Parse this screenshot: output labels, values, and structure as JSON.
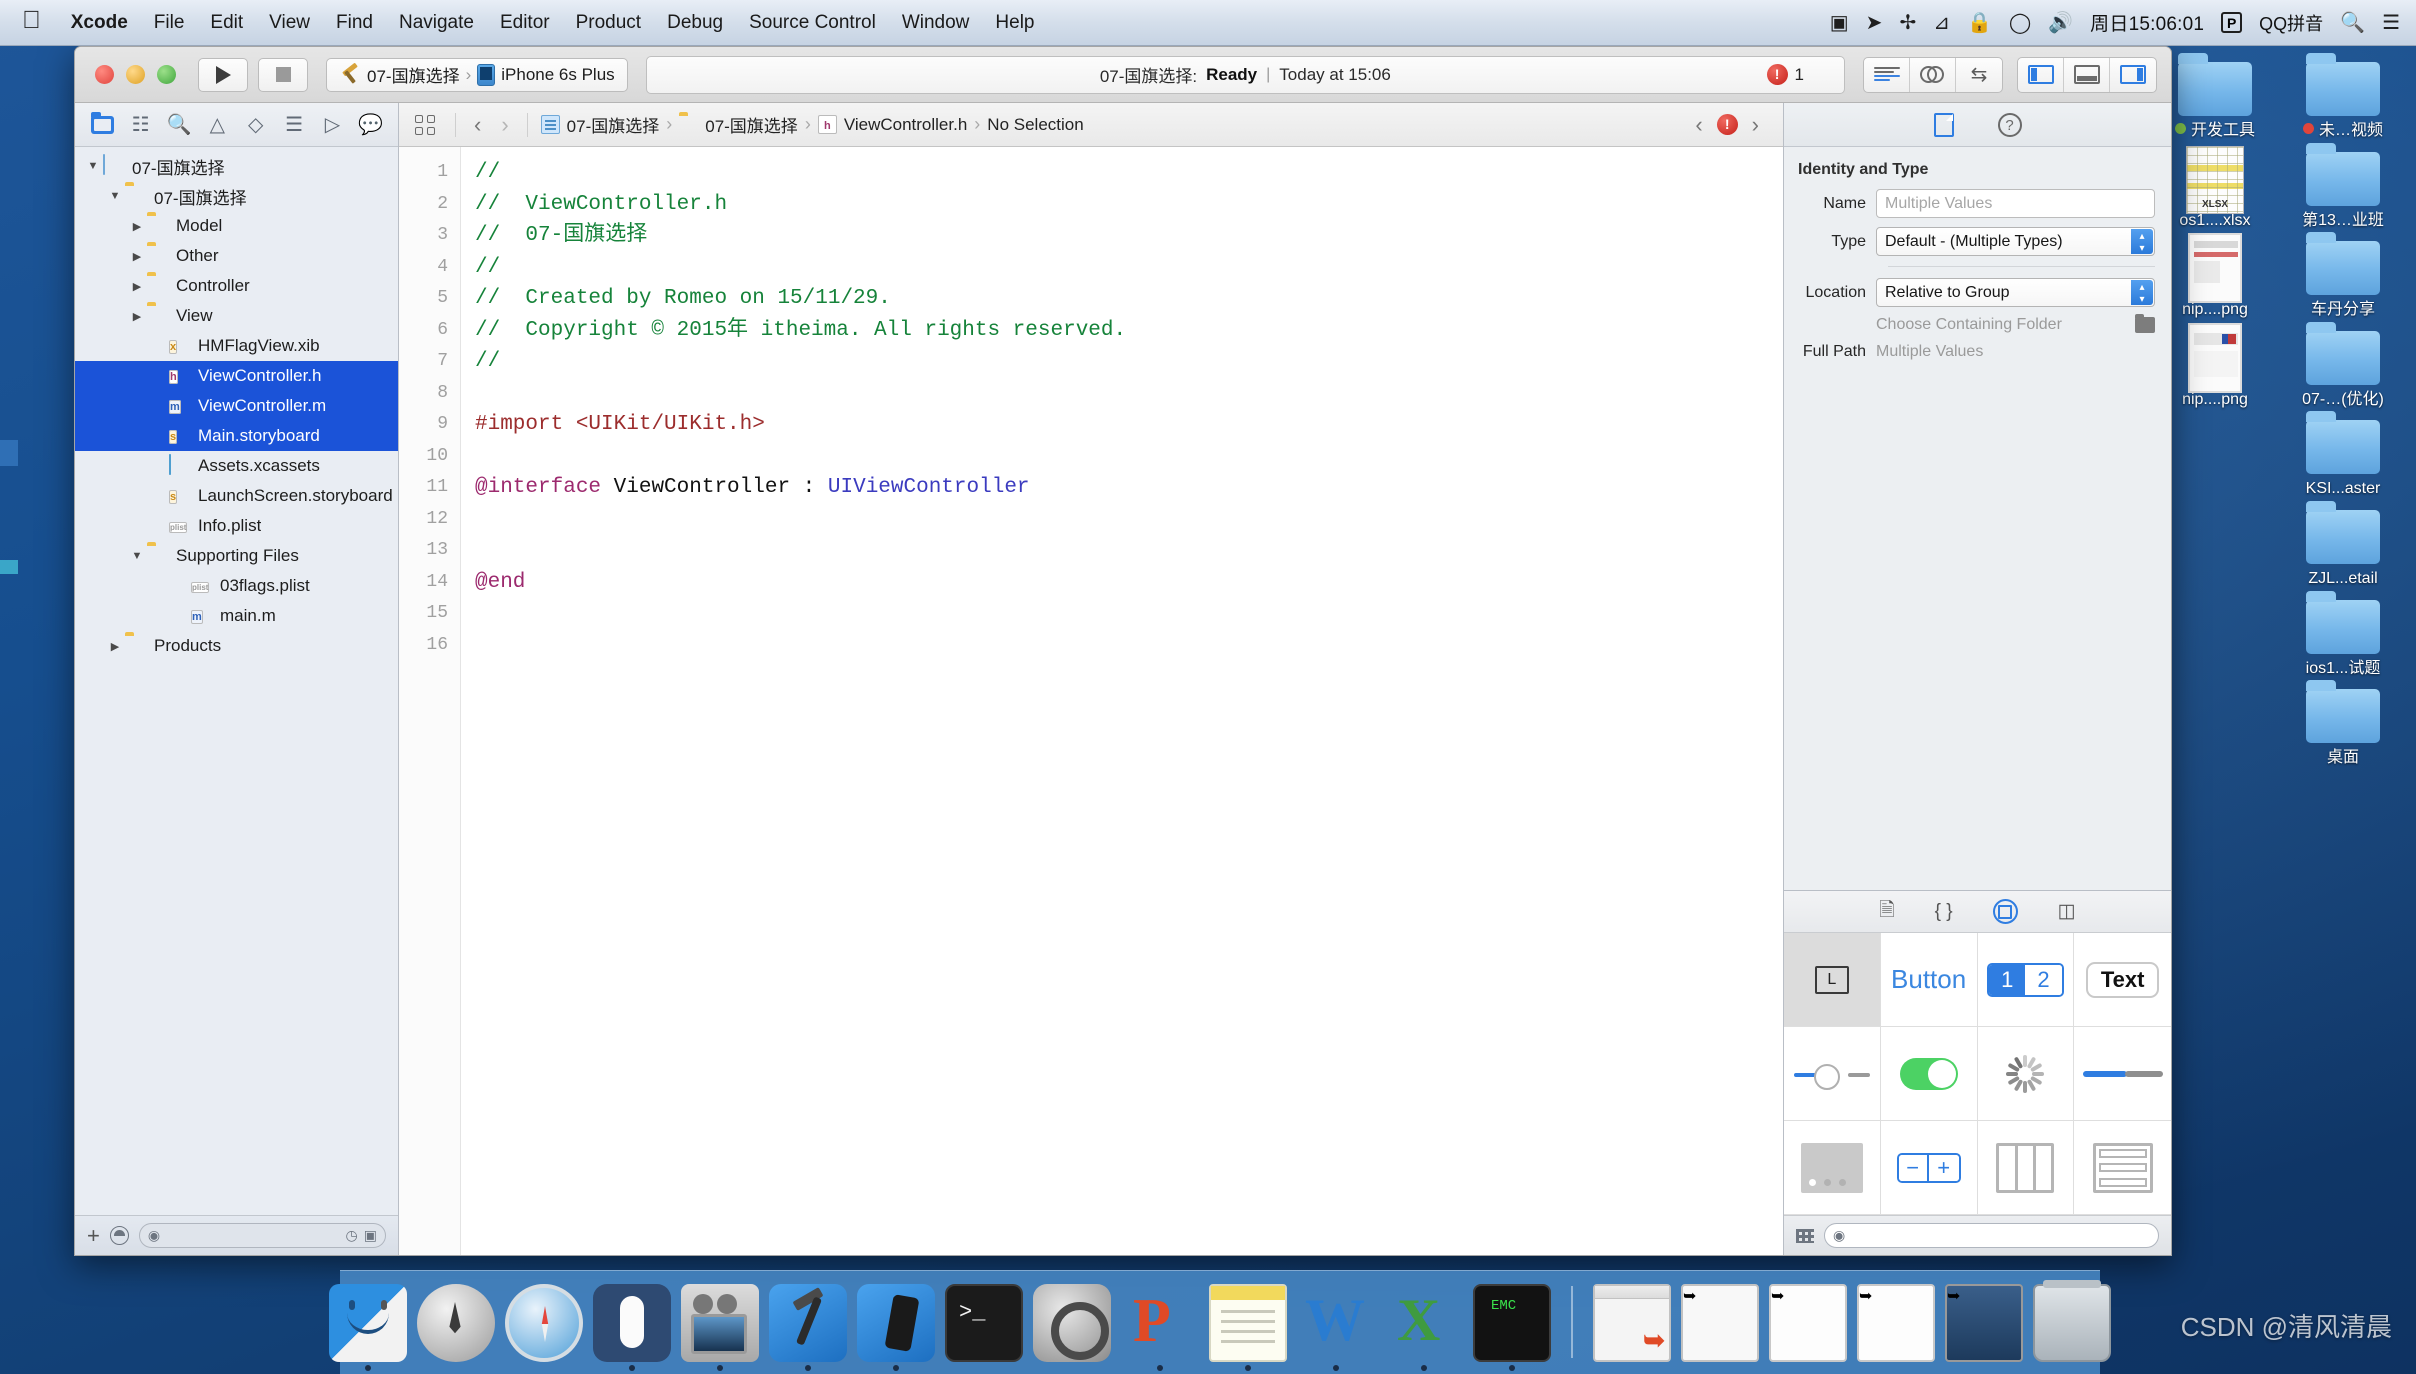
{
  "menubar": {
    "apple_icon": "apple-logo",
    "items": [
      {
        "label": "Xcode",
        "bold": true
      },
      {
        "label": "File",
        "bold": false
      },
      {
        "label": "Edit",
        "bold": false
      },
      {
        "label": "View",
        "bold": false
      },
      {
        "label": "Find",
        "bold": false
      },
      {
        "label": "Navigate",
        "bold": false
      },
      {
        "label": "Editor",
        "bold": false
      },
      {
        "label": "Product",
        "bold": false
      },
      {
        "label": "Debug",
        "bold": false
      },
      {
        "label": "Source Control",
        "bold": false
      },
      {
        "label": "Window",
        "bold": false
      },
      {
        "label": "Help",
        "bold": false
      }
    ],
    "status": {
      "screen_record_icon": "screen-recording-icon",
      "location_icon": "location-arrow-icon",
      "airdrop_icon": "airdrop-icon",
      "bluetooth_icon": "bluetooth-icon",
      "lock_icon": "lock-icon",
      "wifi_icon": "wifi-icon",
      "volume_icon": "volume-icon",
      "clock": "周日15:06:01",
      "parallels_badge": "P",
      "input_method": "QQ拼音",
      "search_icon": "spotlight-search-icon",
      "notification_icon": "notification-center-icon"
    }
  },
  "xcode": {
    "toolbar": {
      "run_label": "Run",
      "stop_label": "Stop",
      "scheme_name": "07-国旗选择",
      "destination_name": "iPhone 6s Plus",
      "activity": {
        "project": "07-国旗选择:",
        "status": "Ready",
        "separator": "|",
        "time": "Today at 15:06"
      },
      "error_count": "1",
      "editor_modes": [
        "standard-editor",
        "assistant-editor",
        "version-editor"
      ],
      "view_toggles": [
        "navigator-toggle",
        "debug-area-toggle",
        "utilities-toggle"
      ]
    },
    "navigator": {
      "tabs": [
        {
          "name": "project-navigator",
          "icon": "folder-icon",
          "selected": true
        },
        {
          "name": "source-control-navigator",
          "icon": "source-control-icon",
          "selected": false
        },
        {
          "name": "symbol-navigator",
          "icon": "search-icon",
          "selected": false
        },
        {
          "name": "issue-navigator",
          "icon": "warning-triangle-icon",
          "selected": false
        },
        {
          "name": "test-navigator",
          "icon": "diamond-icon",
          "selected": false
        },
        {
          "name": "debug-navigator",
          "icon": "bars-icon",
          "selected": false
        },
        {
          "name": "breakpoint-navigator",
          "icon": "tag-icon",
          "selected": false
        },
        {
          "name": "report-navigator",
          "icon": "speech-bubble-icon",
          "selected": false
        }
      ],
      "tree": [
        {
          "label": "07-国旗选择",
          "depth": 0,
          "icon": "project",
          "disclosure": "▼",
          "selected": false
        },
        {
          "label": "07-国旗选择",
          "depth": 1,
          "icon": "folder",
          "disclosure": "▼",
          "selected": false
        },
        {
          "label": "Model",
          "depth": 2,
          "icon": "folder",
          "disclosure": "▶",
          "selected": false
        },
        {
          "label": "Other",
          "depth": 2,
          "icon": "folder",
          "disclosure": "▶",
          "selected": false
        },
        {
          "label": "Controller",
          "depth": 2,
          "icon": "folder",
          "disclosure": "▶",
          "selected": false
        },
        {
          "label": "View",
          "depth": 2,
          "icon": "folder",
          "disclosure": "▶",
          "selected": false
        },
        {
          "label": "HMFlagView.xib",
          "depth": 3,
          "icon": "xib",
          "disclosure": "",
          "selected": false
        },
        {
          "label": "ViewController.h",
          "depth": 3,
          "icon": "h",
          "disclosure": "",
          "selected": true
        },
        {
          "label": "ViewController.m",
          "depth": 3,
          "icon": "m",
          "disclosure": "",
          "selected": true
        },
        {
          "label": "Main.storyboard",
          "depth": 3,
          "icon": "sb",
          "disclosure": "",
          "selected": true
        },
        {
          "label": "Assets.xcassets",
          "depth": 3,
          "icon": "assets",
          "disclosure": "",
          "selected": false
        },
        {
          "label": "LaunchScreen.storyboard",
          "depth": 3,
          "icon": "sb",
          "disclosure": "",
          "selected": false
        },
        {
          "label": "Info.plist",
          "depth": 3,
          "icon": "plist",
          "disclosure": "",
          "selected": false
        },
        {
          "label": "Supporting Files",
          "depth": 2,
          "icon": "folder",
          "disclosure": "▼",
          "selected": false
        },
        {
          "label": "03flags.plist",
          "depth": 4,
          "icon": "plist",
          "disclosure": "",
          "selected": false
        },
        {
          "label": "main.m",
          "depth": 4,
          "icon": "m",
          "disclosure": "",
          "selected": false
        },
        {
          "label": "Products",
          "depth": 1,
          "icon": "folder",
          "disclosure": "▶",
          "selected": false
        }
      ],
      "footer": {
        "add_label": "+",
        "filter_placeholder": "",
        "recent_icon": "clock-icon",
        "source-control-icon": "source-control-filter-icon"
      }
    },
    "editor": {
      "jumpbar": {
        "related_items_icon": "related-items-icon",
        "back_icon": "back-arrow-icon",
        "forward_icon": "forward-arrow-icon",
        "crumbs": [
          {
            "label": "07-国旗选择",
            "icon": "project"
          },
          {
            "label": "07-国旗选择",
            "icon": "folder"
          },
          {
            "label": "ViewController.h",
            "icon": "h"
          },
          {
            "label": "No Selection",
            "icon": ""
          }
        ],
        "issue_prev_icon": "previous-issue-icon",
        "issue_badge_icon": "error-badge-icon",
        "issue_next_icon": "next-issue-icon"
      },
      "line_numbers": [
        "1",
        "2",
        "3",
        "4",
        "5",
        "6",
        "7",
        "8",
        "9",
        "10",
        "11",
        "12",
        "13",
        "14",
        "15",
        "16"
      ],
      "code": [
        [
          {
            "t": "//",
            "c": "cm"
          }
        ],
        [
          {
            "t": "//  ViewController.h",
            "c": "cm"
          }
        ],
        [
          {
            "t": "//  07-国旗选择",
            "c": "cm"
          }
        ],
        [
          {
            "t": "//",
            "c": "cm"
          }
        ],
        [
          {
            "t": "//  Created by Romeo on 15/11/29.",
            "c": "cm"
          }
        ],
        [
          {
            "t": "//  Copyright © 2015年 itheima. All rights reserved.",
            "c": "cm"
          }
        ],
        [
          {
            "t": "//",
            "c": "cm"
          }
        ],
        [],
        [
          {
            "t": "#import ",
            "c": "pp"
          },
          {
            "t": "<UIKit/UIKit.h>",
            "c": "pp"
          }
        ],
        [],
        [
          {
            "t": "@interface",
            "c": "kw"
          },
          {
            "t": " ViewController ",
            "c": "pl"
          },
          {
            "t": ": ",
            "c": "pl"
          },
          {
            "t": "UIViewController",
            "c": "ty"
          }
        ],
        [],
        [],
        [
          {
            "t": "@end",
            "c": "kw"
          }
        ],
        [],
        []
      ]
    },
    "utilities": {
      "tabs": [
        {
          "name": "file-inspector",
          "icon": "file-icon",
          "selected": true
        },
        {
          "name": "quick-help-inspector",
          "icon": "question-mark-icon",
          "selected": false
        }
      ],
      "identity_section_title": "Identity and Type",
      "rows": [
        {
          "label": "Name",
          "value": "Multiple Values",
          "kind": "field"
        },
        {
          "label": "Type",
          "value": "Default - (Multiple Types)",
          "kind": "select"
        },
        {
          "label": "Location",
          "value": "Relative to Group",
          "kind": "select"
        },
        {
          "label": "",
          "value": "Choose Containing Folder",
          "kind": "folder"
        },
        {
          "label": "Full Path",
          "value": "Multiple Values",
          "kind": "static"
        }
      ],
      "library": {
        "tabs": [
          {
            "name": "file-template-library",
            "icon": "file-template-icon",
            "selected": false
          },
          {
            "name": "code-snippet-library",
            "icon": "code-braces-icon",
            "selected": false
          },
          {
            "name": "object-library",
            "icon": "object-circle-icon",
            "selected": true
          },
          {
            "name": "media-library",
            "icon": "media-icon",
            "selected": false
          }
        ],
        "objects": [
          {
            "name": "label-object",
            "label": "L",
            "kind": "label",
            "active": true
          },
          {
            "name": "button-object",
            "label": "Button",
            "kind": "button",
            "active": false
          },
          {
            "name": "segmented-control-object",
            "label": "1 2",
            "kind": "segmented",
            "active": false
          },
          {
            "name": "text-field-object",
            "label": "Text",
            "kind": "text",
            "active": false
          },
          {
            "name": "slider-object",
            "label": "",
            "kind": "slider",
            "active": false
          },
          {
            "name": "switch-object",
            "label": "",
            "kind": "switch",
            "active": false
          },
          {
            "name": "activity-indicator-object",
            "label": "",
            "kind": "spinner",
            "active": false
          },
          {
            "name": "progress-view-object",
            "label": "",
            "kind": "progress",
            "active": false
          },
          {
            "name": "page-control-object",
            "label": "",
            "kind": "page",
            "active": false
          },
          {
            "name": "stepper-object",
            "label": "",
            "kind": "stepper",
            "active": false
          },
          {
            "name": "collection-view-object",
            "label": "",
            "kind": "cols",
            "active": false
          },
          {
            "name": "table-view-object",
            "label": "",
            "kind": "rows",
            "active": false
          }
        ],
        "footer": {
          "layout_icon": "grid-layout-icon",
          "filter_placeholder": ""
        }
      }
    }
  },
  "desktop": {
    "icons": [
      {
        "label": "开发工具",
        "kind": "folder",
        "dot": "#7fc14a"
      },
      {
        "label": "未…视频",
        "kind": "folder",
        "dot": "#e0453b"
      },
      {
        "label": "os1....xlsx",
        "kind": "xlsx",
        "dot": ""
      },
      {
        "label": "第13…业班",
        "kind": "folder",
        "dot": ""
      },
      {
        "label": "nip....png",
        "kind": "png",
        "dot": ""
      },
      {
        "label": "车丹分享",
        "kind": "folder",
        "dot": ""
      },
      {
        "label": "nip....png",
        "kind": "png",
        "dot": ""
      },
      {
        "label": "07-…(优化)",
        "kind": "folder",
        "dot": ""
      },
      {
        "label": "",
        "kind": "blank",
        "dot": ""
      },
      {
        "label": "KSI...aster",
        "kind": "folder",
        "dot": ""
      },
      {
        "label": "",
        "kind": "blank",
        "dot": ""
      },
      {
        "label": "ZJL...etail",
        "kind": "folder",
        "dot": ""
      },
      {
        "label": "",
        "kind": "blank",
        "dot": ""
      },
      {
        "label": "ios1...试题",
        "kind": "folder",
        "dot": ""
      },
      {
        "label": "",
        "kind": "blank",
        "dot": ""
      },
      {
        "label": "桌面",
        "kind": "folder",
        "dot": ""
      }
    ]
  },
  "dock": {
    "items": [
      {
        "name": "finder",
        "cls": "finder",
        "running": true
      },
      {
        "name": "launchpad",
        "cls": "launchpad",
        "running": false
      },
      {
        "name": "safari",
        "cls": "safari",
        "running": false
      },
      {
        "name": "mouse-utility",
        "cls": "mouseapp",
        "running": true
      },
      {
        "name": "quicktime-player",
        "cls": "quicktime",
        "running": true
      },
      {
        "name": "xcode",
        "cls": "xcodeicon",
        "running": true
      },
      {
        "name": "ios-simulator",
        "cls": "simicon",
        "running": true
      },
      {
        "name": "terminal",
        "cls": "terminal",
        "running": false
      },
      {
        "name": "system-preferences",
        "cls": "sysprefs",
        "running": false
      },
      {
        "name": "powerpoint",
        "cls": "pptapp",
        "running": true
      },
      {
        "name": "notes",
        "cls": "notesapp",
        "running": true
      },
      {
        "name": "word",
        "cls": "wordapp",
        "running": true
      },
      {
        "name": "excel",
        "cls": "excelapp",
        "running": true
      },
      {
        "name": "emc-terminal",
        "cls": "emcapp",
        "running": true
      },
      {
        "name": "separator",
        "cls": "sep",
        "running": false
      },
      {
        "name": "minimized-window-1",
        "cls": "minwin",
        "running": false
      },
      {
        "name": "minimized-window-2",
        "cls": "minwin2",
        "running": false
      },
      {
        "name": "minimized-window-3",
        "cls": "minwin3",
        "running": false
      },
      {
        "name": "minimized-window-4",
        "cls": "minwin3",
        "running": false
      },
      {
        "name": "minimized-window-5",
        "cls": "minwin4",
        "running": false
      },
      {
        "name": "trash",
        "cls": "trash",
        "running": false
      }
    ]
  },
  "watermark": {
    "text": "CSDN @清风清晨"
  }
}
